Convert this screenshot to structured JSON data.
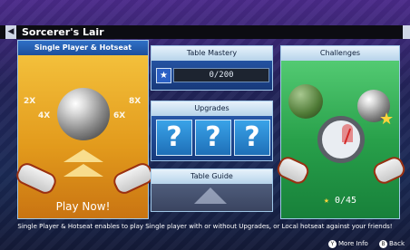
{
  "header": {
    "title": "Sorcerer's Lair"
  },
  "cards": {
    "single": {
      "label": "Single Player & Hotseat",
      "cta": "Play Now!",
      "multipliers": [
        "2X",
        "4X",
        "6X",
        "8X"
      ]
    },
    "mastery": {
      "label": "Table Mastery",
      "progress_text": "0/200"
    },
    "upgrades": {
      "label": "Upgrades",
      "slots": [
        "?",
        "?",
        "?"
      ]
    },
    "guide": {
      "label": "Table Guide"
    },
    "challenges": {
      "label": "Challenges",
      "count_text": "0/45"
    }
  },
  "description": "Single Player & Hotseat enables to play Single player with or without Upgrades, or Local hotseat against your friends!",
  "footer": {
    "more_info": "More Info",
    "back": "Back",
    "more_info_key": "Y",
    "back_key": "B"
  },
  "colors": {
    "accent": "#2f6fc6",
    "card_border": "#9fc7e8",
    "challenge_green": "#28a04a",
    "single_gold": "#e29a1c"
  }
}
